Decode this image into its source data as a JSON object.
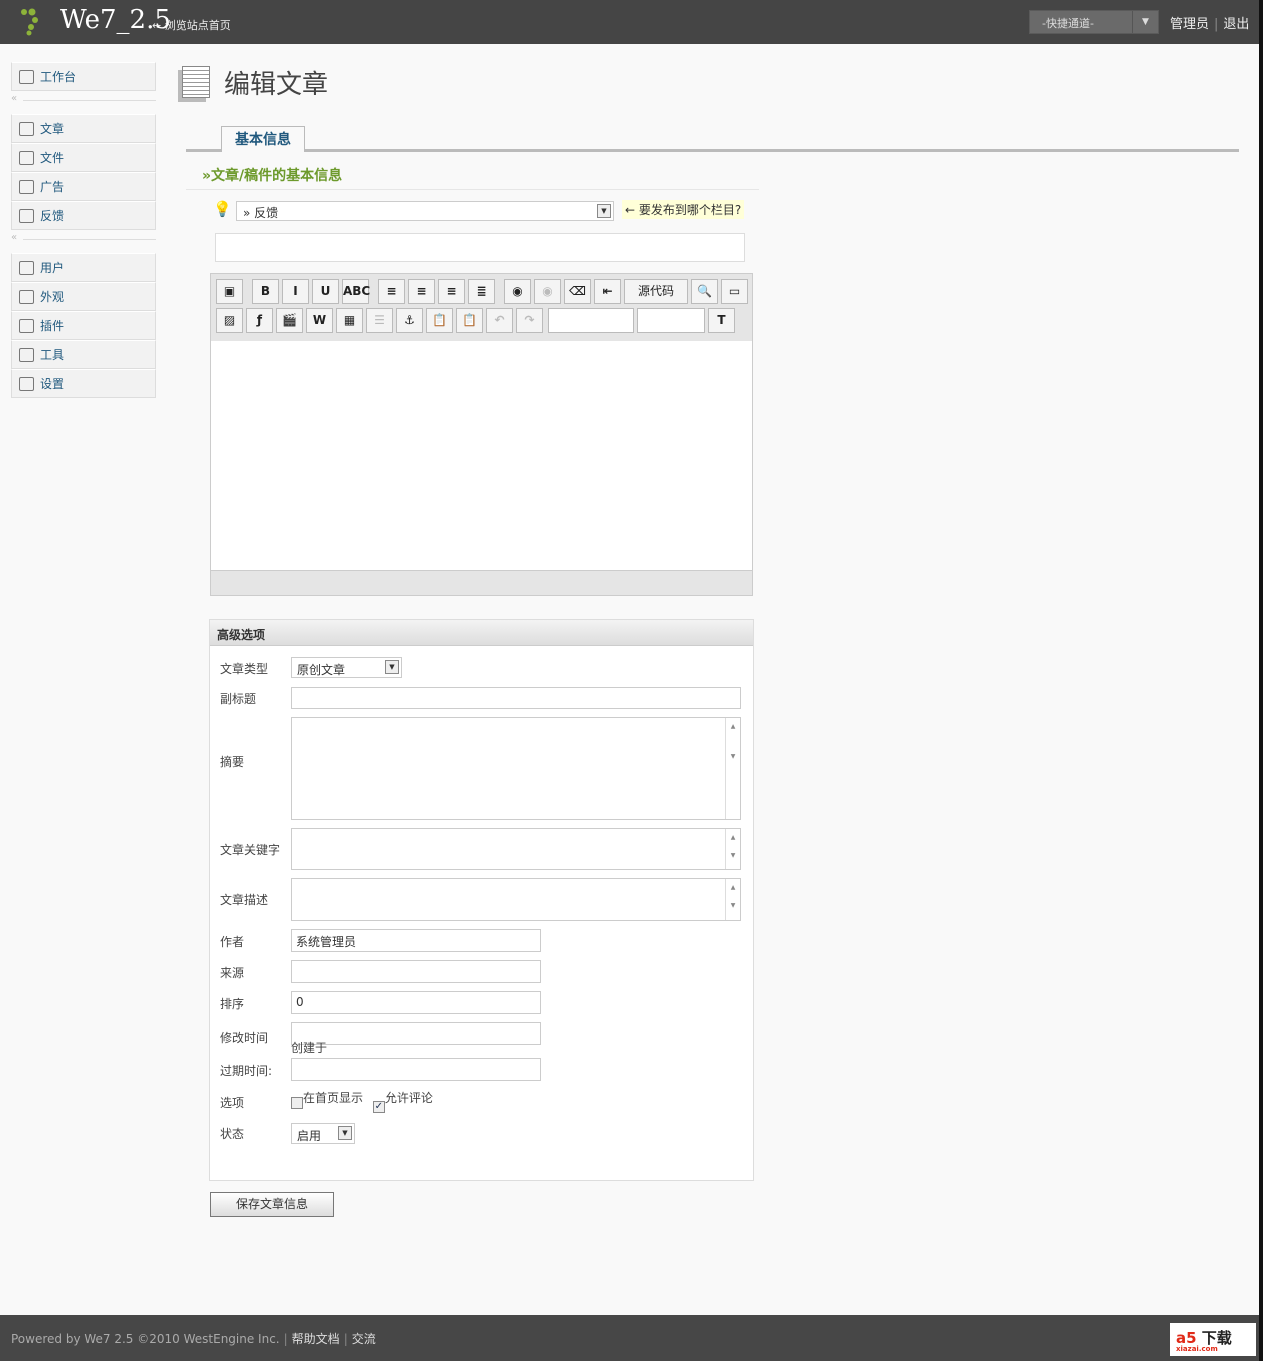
{
  "header": {
    "site_title": "We7_2.5",
    "browse_link": "← 浏览站点首页",
    "quick_nav": "-快捷通道-",
    "user": "管理员",
    "logout": "退出"
  },
  "sidebar": {
    "groups": [
      [
        {
          "label": "工作台",
          "icon": "home-icon"
        }
      ],
      [
        {
          "label": "文章",
          "icon": "article-icon"
        },
        {
          "label": "文件",
          "icon": "file-icon"
        },
        {
          "label": "广告",
          "icon": "ad-icon"
        },
        {
          "label": "反馈",
          "icon": "feedback-icon"
        }
      ],
      [
        {
          "label": "用户",
          "icon": "users-icon"
        },
        {
          "label": "外观",
          "icon": "appearance-icon"
        },
        {
          "label": "插件",
          "icon": "plugin-icon"
        },
        {
          "label": "工具",
          "icon": "tools-icon"
        },
        {
          "label": "设置",
          "icon": "settings-icon"
        }
      ]
    ]
  },
  "page": {
    "title": "编辑文章",
    "tab": "基本信息",
    "section": "»文章/稿件的基本信息",
    "category": "» 反馈",
    "category_hint": "← 要发布到哪个栏目?",
    "title_value": ""
  },
  "editor": {
    "source_label": "源代码",
    "row1": [
      {
        "n": "save",
        "g": "▣"
      },
      {
        "n": "bold",
        "g": "B",
        "gap": 1
      },
      {
        "n": "italic",
        "g": "I"
      },
      {
        "n": "underline",
        "g": "U"
      },
      {
        "n": "strikethrough",
        "g": "ABC"
      },
      {
        "n": "align-left",
        "g": "≡",
        "gap": 1
      },
      {
        "n": "align-center",
        "g": "≡"
      },
      {
        "n": "align-right",
        "g": "≡"
      },
      {
        "n": "justify",
        "g": "≣"
      },
      {
        "n": "link",
        "g": "◉",
        "gap": 1
      },
      {
        "n": "unlink",
        "g": "◉",
        "dis": 1
      },
      {
        "n": "eraser",
        "g": "⌫"
      },
      {
        "n": "indent",
        "g": "⇤"
      },
      {
        "n": "source",
        "g": "源代码",
        "wide": 1
      },
      {
        "n": "preview",
        "g": "🔍"
      },
      {
        "n": "fullscreen",
        "g": "▭"
      }
    ],
    "row2": [
      {
        "n": "image",
        "g": "▨"
      },
      {
        "n": "flash",
        "g": "ƒ"
      },
      {
        "n": "media",
        "g": "🎬"
      },
      {
        "n": "paste-word",
        "g": "W"
      },
      {
        "n": "table",
        "g": "▦"
      },
      {
        "n": "hr",
        "g": "☰",
        "dis": 1
      },
      {
        "n": "anchor",
        "g": "⚓"
      },
      {
        "n": "paste-text",
        "g": "📋",
        "dis": 1
      },
      {
        "n": "paste-word2",
        "g": "📋",
        "dis": 1
      },
      {
        "n": "undo",
        "g": "↶",
        "dis": 1
      },
      {
        "n": "redo",
        "g": "↷",
        "dis": 1
      }
    ]
  },
  "advanced": {
    "heading": "高级选项",
    "type_label": "文章类型",
    "type_value": "原创文章",
    "subtitle_label": "副标题",
    "subtitle_value": "",
    "summary_label": "摘要",
    "keywords_label": "文章关键字",
    "desc_label": "文章描述",
    "author_label": "作者",
    "author_value": "系统管理员",
    "source_label": "来源",
    "source_value": "",
    "order_label": "排序",
    "order_value": "0",
    "modified_label": "修改时间",
    "created_text": "创建于",
    "expire_label": "过期时间:",
    "options_label": "选项",
    "opt_home": "在首页显示",
    "opt_home_checked": false,
    "opt_comment": "允许评论",
    "opt_comment_checked": true,
    "state_label": "状态",
    "state_value": "启用"
  },
  "save_button": "保存文章信息",
  "footer": {
    "powered": "Powered by We7 2.5 ©2010 WestEngine Inc.",
    "help": "帮助文档",
    "chat": "交流",
    "badge_brand": "a5",
    "badge_text": "下载",
    "badge_domain": "xiazai.com"
  }
}
